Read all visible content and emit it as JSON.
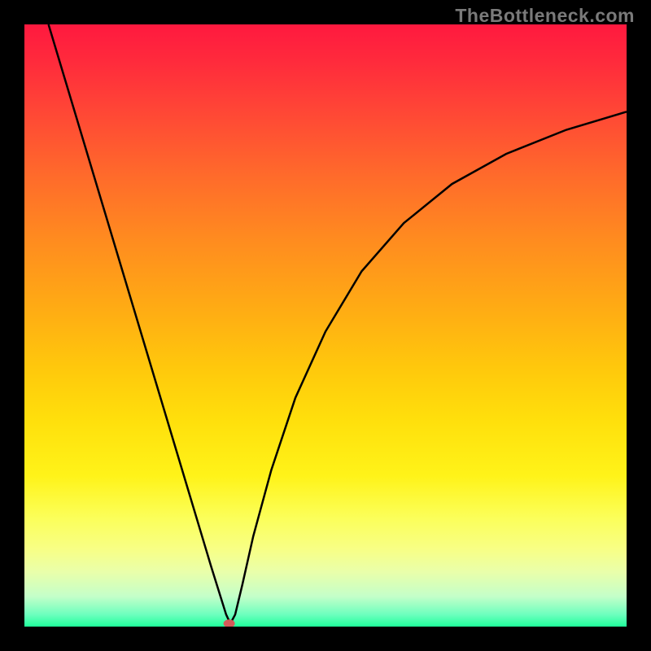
{
  "watermark": "TheBottleneck.com",
  "chart_data": {
    "type": "line",
    "title": "",
    "xlabel": "",
    "ylabel": "",
    "xlim": [
      0,
      100
    ],
    "ylim": [
      0,
      100
    ],
    "grid": false,
    "series": [
      {
        "name": "curve",
        "x_unit": "percent-of-width",
        "y_unit": "percent-of-height-from-bottom",
        "points": [
          {
            "x": 4.0,
            "y": 100.0
          },
          {
            "x": 7.0,
            "y": 90.0
          },
          {
            "x": 10.0,
            "y": 80.0
          },
          {
            "x": 13.0,
            "y": 70.0
          },
          {
            "x": 16.0,
            "y": 60.0
          },
          {
            "x": 19.0,
            "y": 50.0
          },
          {
            "x": 22.0,
            "y": 40.0
          },
          {
            "x": 25.0,
            "y": 30.0
          },
          {
            "x": 28.0,
            "y": 20.0
          },
          {
            "x": 31.0,
            "y": 10.0
          },
          {
            "x": 33.5,
            "y": 2.0
          },
          {
            "x": 34.2,
            "y": 0.5
          },
          {
            "x": 35.0,
            "y": 2.0
          },
          {
            "x": 36.2,
            "y": 7.0
          },
          {
            "x": 38.0,
            "y": 15.0
          },
          {
            "x": 41.0,
            "y": 26.0
          },
          {
            "x": 45.0,
            "y": 38.0
          },
          {
            "x": 50.0,
            "y": 49.0
          },
          {
            "x": 56.0,
            "y": 59.0
          },
          {
            "x": 63.0,
            "y": 67.0
          },
          {
            "x": 71.0,
            "y": 73.5
          },
          {
            "x": 80.0,
            "y": 78.5
          },
          {
            "x": 90.0,
            "y": 82.5
          },
          {
            "x": 100.0,
            "y": 85.5
          }
        ]
      }
    ],
    "marker": {
      "x": 34.0,
      "y": 0.5,
      "color": "#d55a5a"
    },
    "background_gradient": [
      {
        "stop": 0.0,
        "color": "#ff193f"
      },
      {
        "stop": 0.5,
        "color": "#ffc80c"
      },
      {
        "stop": 0.85,
        "color": "#fbff5a"
      },
      {
        "stop": 1.0,
        "color": "#20ff9b"
      }
    ]
  }
}
